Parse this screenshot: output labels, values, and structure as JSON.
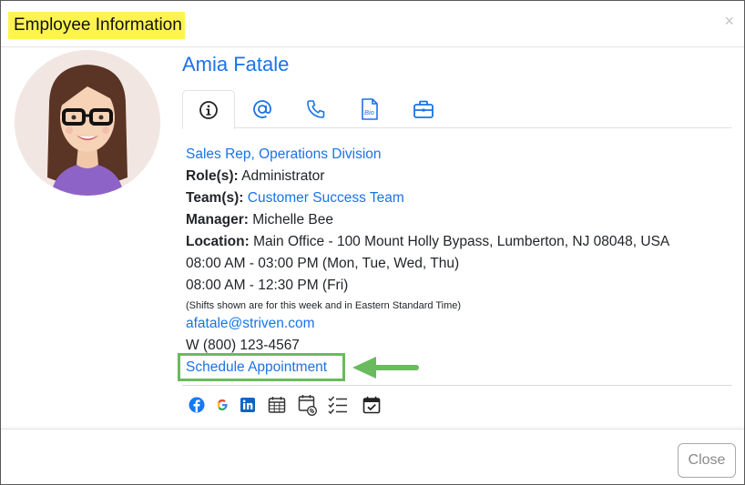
{
  "dialog": {
    "title": "Employee Information",
    "close_icon": "×",
    "footer": {
      "close_label": "Close"
    }
  },
  "employee": {
    "name": "Amia Fatale",
    "title_division": "Sales Rep, Operations Division",
    "roles_label": "Role(s):",
    "roles_value": "Administrator",
    "teams_label": "Team(s):",
    "teams_value": "Customer Success Team",
    "manager_label": "Manager:",
    "manager_value": "Michelle Bee",
    "location_label": "Location:",
    "location_value": "Main Office - 100 Mount Holly Bypass, Lumberton, NJ 08048, USA",
    "schedule": [
      "08:00 AM - 03:00 PM (Mon, Tue, Wed, Thu)",
      "08:00 AM - 12:30 PM (Fri)"
    ],
    "schedule_note": "(Shifts shown are for this week and in Eastern Standard Time)",
    "email": "afatale@striven.com",
    "phone": "W (800) 123-4567",
    "schedule_appointment": "Schedule Appointment"
  },
  "tabs": [
    {
      "icon": "info-icon",
      "active": true
    },
    {
      "icon": "at-icon",
      "active": false
    },
    {
      "icon": "phone-icon",
      "active": false
    },
    {
      "icon": "bio-document-icon",
      "active": false,
      "text": "Bio"
    },
    {
      "icon": "briefcase-icon",
      "active": false
    }
  ],
  "social_icons": [
    "facebook-icon",
    "google-icon",
    "linkedin-icon",
    "calendar-grid-icon",
    "calendar-link-icon",
    "checklist-icon",
    "calendar-check-icon"
  ],
  "colors": {
    "link": "#1a73e8",
    "title_highlight": "#fff44f",
    "annotation_green": "#6aba5e"
  }
}
